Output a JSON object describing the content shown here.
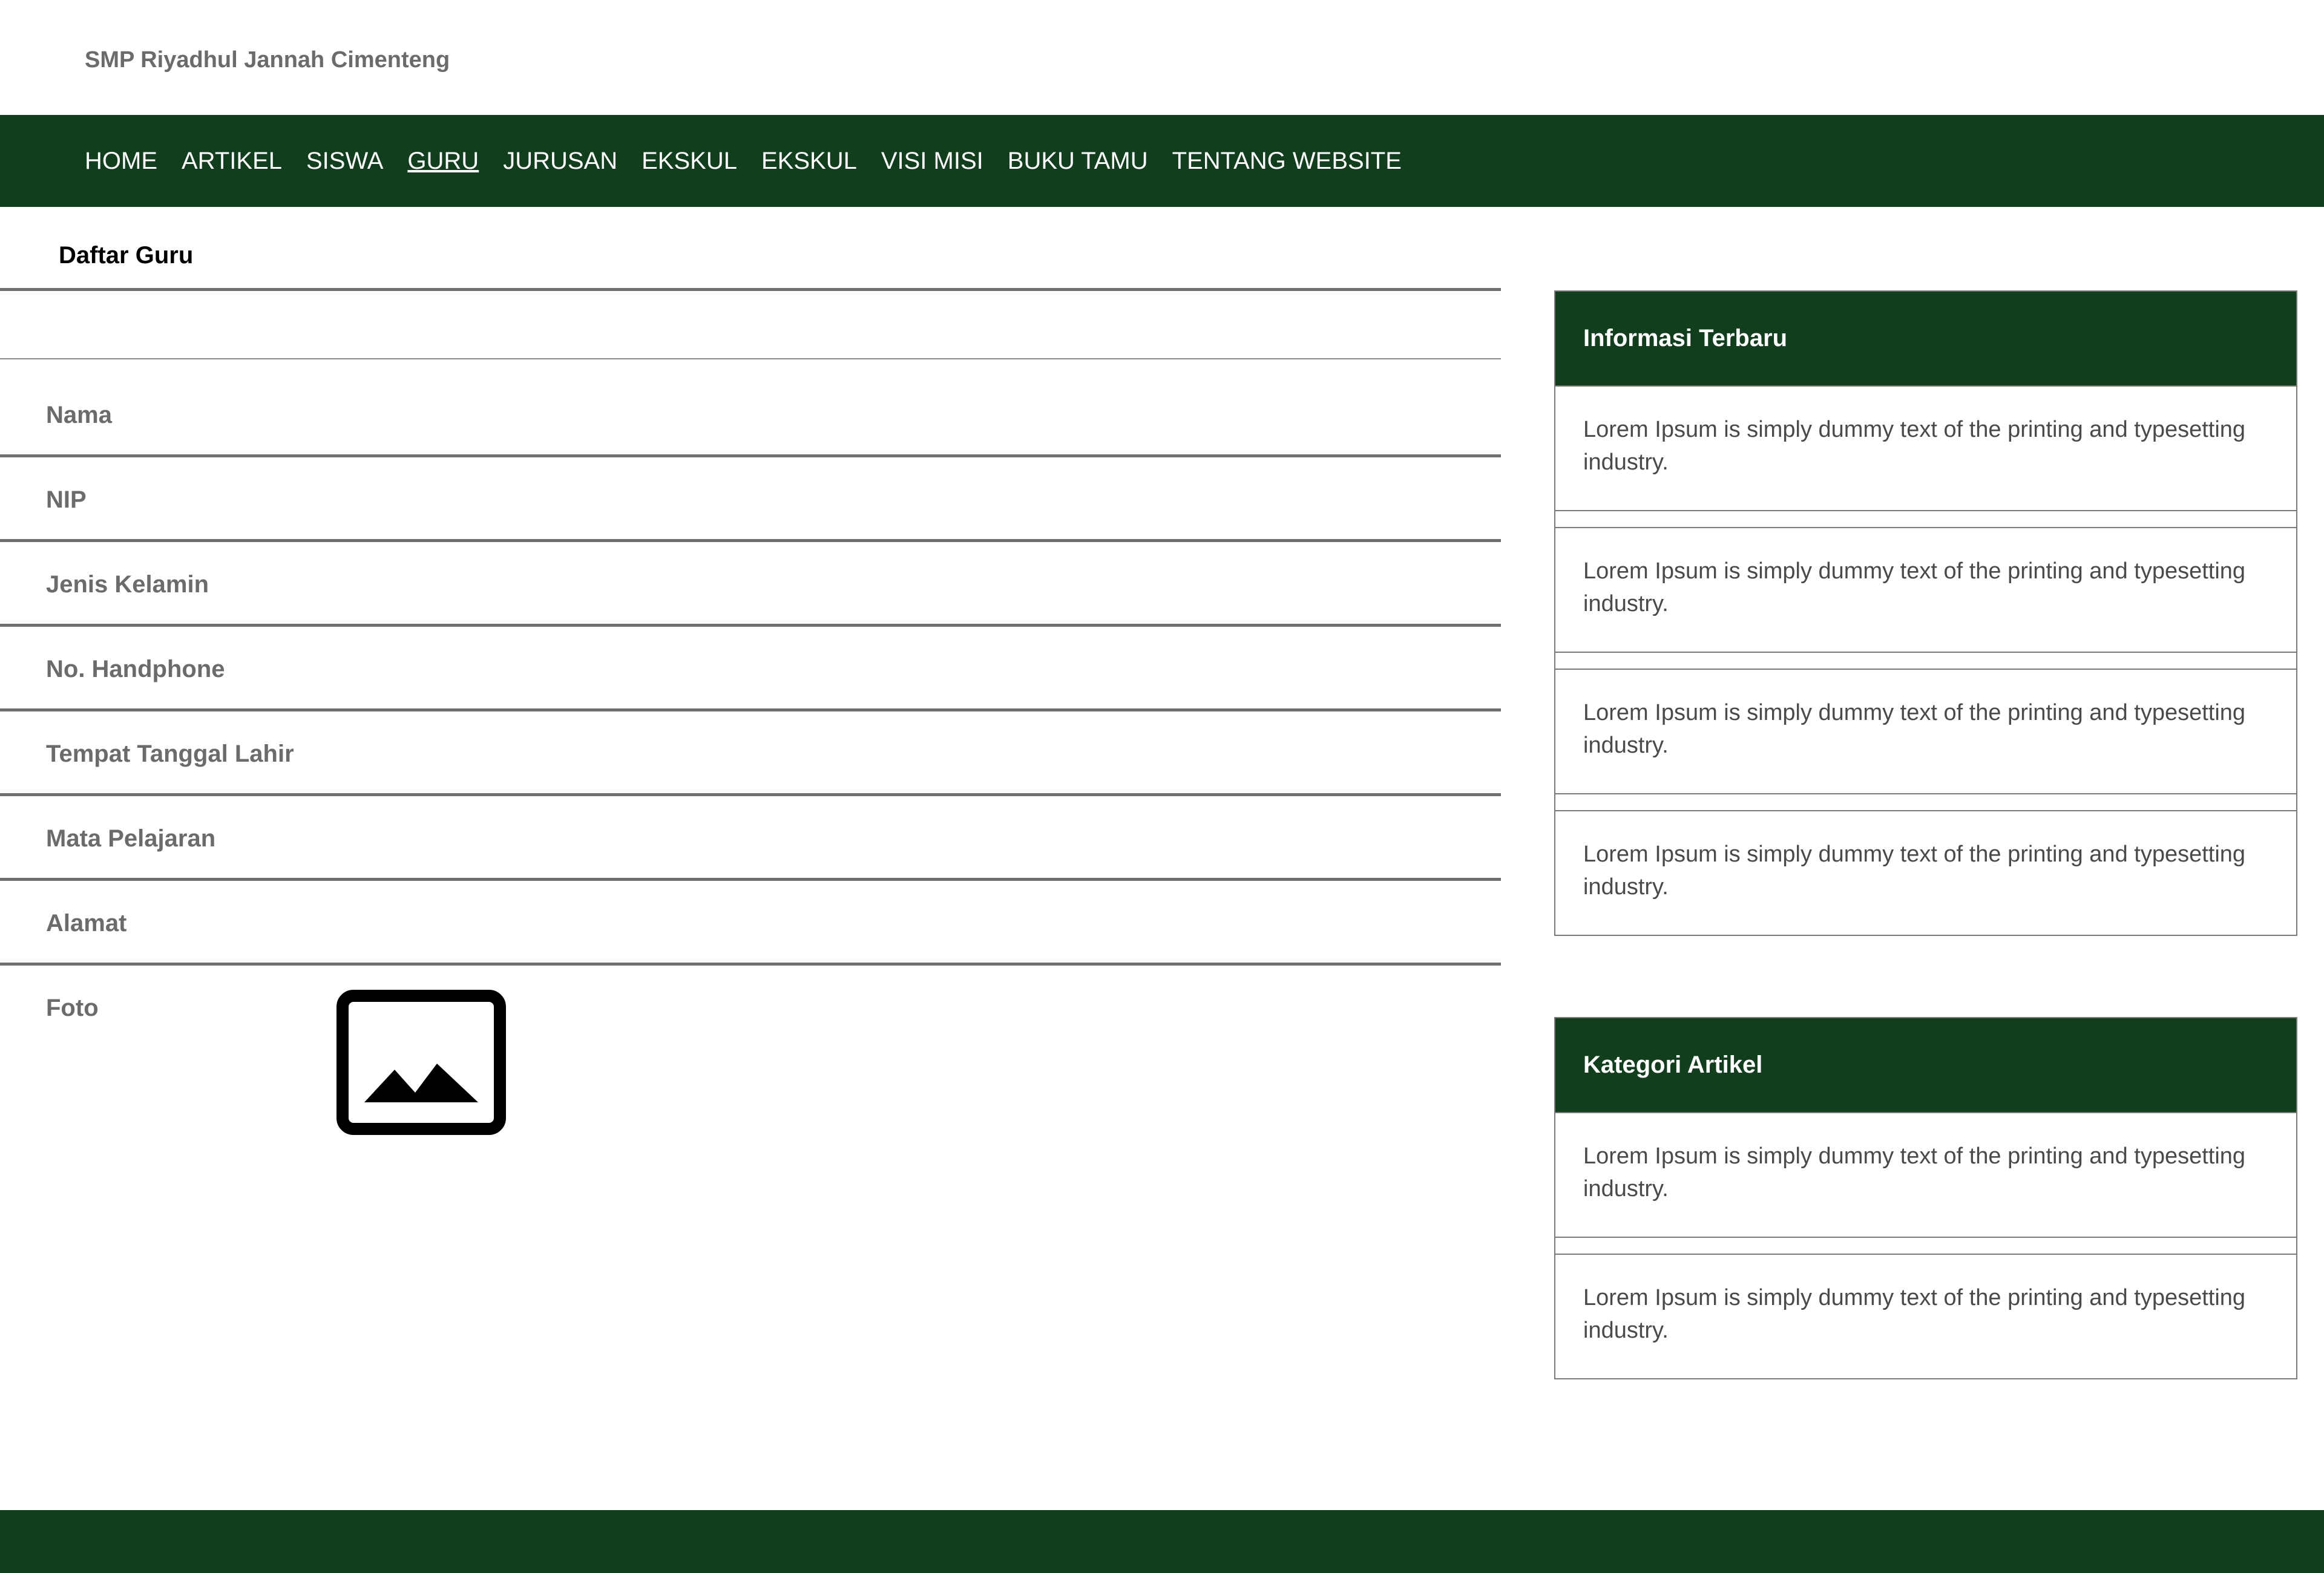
{
  "site": {
    "title": "SMP Riyadhul Jannah Cimenteng"
  },
  "nav": {
    "items": [
      {
        "label": "HOME"
      },
      {
        "label": "ARTIKEL"
      },
      {
        "label": "SISWA"
      },
      {
        "label": "GURU"
      },
      {
        "label": "JURUSAN"
      },
      {
        "label": "EKSKUL"
      },
      {
        "label": "EKSKUL"
      },
      {
        "label": "VISI MISI"
      },
      {
        "label": "BUKU TAMU"
      },
      {
        "label": "TENTANG WEBSITE"
      }
    ],
    "active": "GURU"
  },
  "main": {
    "heading": "Daftar Guru",
    "fields": [
      {
        "label": "Nama",
        "value": ""
      },
      {
        "label": "NIP",
        "value": ""
      },
      {
        "label": "Jenis Kelamin",
        "value": ""
      },
      {
        "label": "No. Handphone",
        "value": ""
      },
      {
        "label": "Tempat Tanggal Lahir",
        "value": ""
      },
      {
        "label": "Mata Pelajaran",
        "value": ""
      },
      {
        "label": "Alamat",
        "value": ""
      },
      {
        "label": "Foto",
        "value": ""
      }
    ],
    "photo_icon": "image-placeholder-icon"
  },
  "sidebar": {
    "info": {
      "title": "Informasi Terbaru",
      "items": [
        {
          "text": "Lorem Ipsum is simply dummy text of the printing and typesetting industry."
        },
        {
          "text": "Lorem Ipsum is simply dummy text of the printing and typesetting industry."
        },
        {
          "text": "Lorem Ipsum is simply dummy text of the printing and typesetting industry."
        },
        {
          "text": "Lorem Ipsum is simply dummy text of the printing and typesetting industry."
        }
      ]
    },
    "categories": {
      "title": "Kategori Artikel",
      "items": [
        {
          "text": "Lorem Ipsum is simply dummy text of the printing and typesetting industry."
        },
        {
          "text": "Lorem Ipsum is simply dummy text of the printing and typesetting industry."
        }
      ]
    }
  },
  "colors": {
    "primary": "#113f1d",
    "label_gray": "#6b6b6b"
  }
}
